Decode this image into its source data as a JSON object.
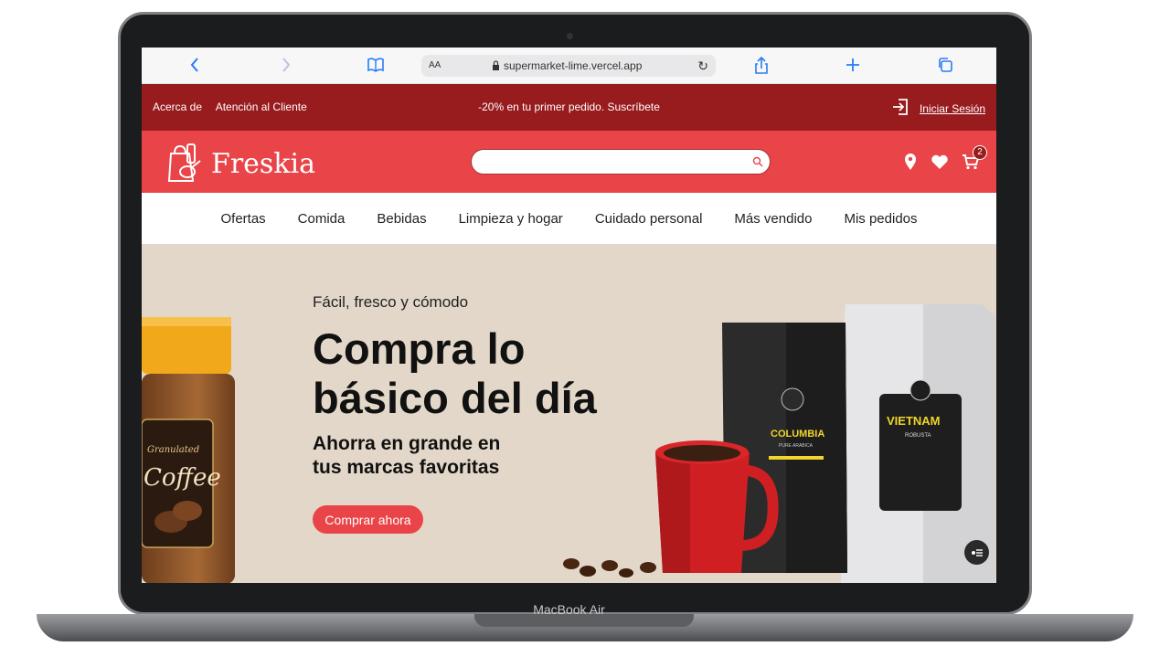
{
  "device": {
    "label": "MacBook Air"
  },
  "browser": {
    "url": "supermarket-lime.vercel.app",
    "text_size_label": "AA"
  },
  "promo_bar": {
    "links": [
      "Acerca de",
      "Atención al Cliente"
    ],
    "promo_text": "-20% en tu primer pedido. Suscríbete",
    "login_label": "Iniciar Sesión"
  },
  "header": {
    "brand": "Freskia",
    "search_placeholder": "",
    "cart_count": "2"
  },
  "nav": {
    "items": [
      "Ofertas",
      "Comida",
      "Bebidas",
      "Limpieza y hogar",
      "Cuidado personal",
      "Más vendido",
      "Mis pedidos"
    ]
  },
  "hero": {
    "eyebrow": "Fácil, fresco y cómodo",
    "title_line1": "Compra lo",
    "title_line2": "básico del día",
    "subtitle_line1": "Ahorra en grande en",
    "subtitle_line2": "tus marcas favoritas",
    "cta_label": "Comprar ahora",
    "jar_label_top": "Granulated",
    "jar_label_main": "Coffee",
    "bag1_label": "COLUMBIA",
    "bag1_sub": "PURE ARABICA",
    "bag2_label": "VIETNAM",
    "bag2_sub": "ROBUSTA"
  },
  "colors": {
    "primary_red": "#e94447",
    "dark_red": "#981b1e",
    "hero_bg": "#e2d7c8",
    "browser_blue": "#2a7bf6"
  }
}
